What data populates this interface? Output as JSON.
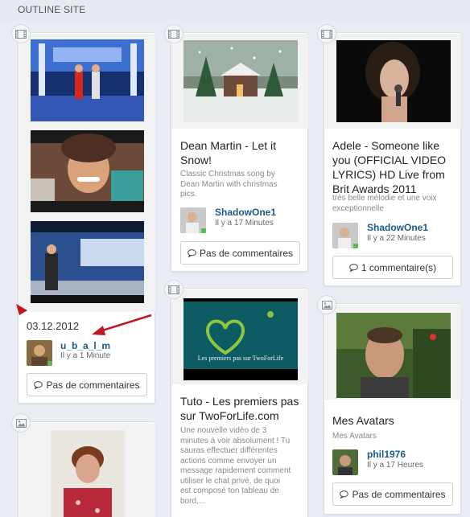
{
  "site": {
    "title": "OUTLINE SITE"
  },
  "colors": {
    "link": "#1a5a8a",
    "online": "#5cb85c",
    "arrow": "#c0161d"
  },
  "cards": {
    "gallery": {
      "icon": "film-icon",
      "date": "03.12.2012",
      "user": "u_b_a_l_m",
      "time": "Il y a 1 Minute",
      "comments": "Pas de commentaires"
    },
    "dean": {
      "icon": "film-icon",
      "title": "Dean Martin - Let it Snow!",
      "description": "Classic Christmas song by Dean Martin with christmas pics.",
      "user": "ShadowOne1",
      "time": "Il y a 17 Minutes",
      "comments": "Pas de commentaires"
    },
    "adele": {
      "icon": "film-icon",
      "title": "Adele - Someone like you (OFFICIAL VIDEO LYRICS) HD Live from Brit Awards 2011",
      "description": "très belle mélodie et une voix exceptionnelle",
      "user": "ShadowOne1",
      "time": "Il y a 22 Minutes",
      "comments": "1 commentaire(s)"
    },
    "tuto": {
      "icon": "film-icon",
      "thumb_text": "Les premiers pas sur TwoForLife",
      "title": "Tuto - Les premiers pas sur TwoForLife.com",
      "description": "Une nouvelle vidéo de 3 minutes à voir absolument ! Tu sauras effectuer différentes actions comme envoyer un message rapidement comment utiliser le chat privé, de quoi est composé ton tableau de bord,..."
    },
    "avatars": {
      "icon": "image-icon",
      "title": "Mes Avatars",
      "description": "Mes Avatars",
      "user": "phil1976",
      "time": "Il y a 17 Heures",
      "comments": "Pas de commentaires"
    },
    "photo": {
      "icon": "image-icon"
    }
  }
}
